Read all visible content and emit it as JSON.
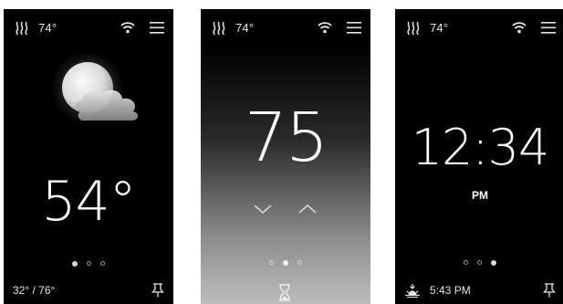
{
  "screens": [
    {
      "id": "weather",
      "status": {
        "temperature": "74°"
      },
      "weather_icon": "moon-behind-cloud-icon",
      "main_value": "54°",
      "pager": {
        "count": 3,
        "active": 0
      },
      "footer": {
        "range": "32° / 76°",
        "pin_icon": "pin-icon"
      }
    },
    {
      "id": "setpoint",
      "status": {
        "temperature": "74°"
      },
      "main_value": "75",
      "controls": {
        "decrease_icon": "chevron-down-icon",
        "increase_icon": "chevron-up-icon"
      },
      "pager": {
        "count": 3,
        "active": 1
      },
      "footer": {
        "timer_icon": "hourglass-icon"
      }
    },
    {
      "id": "clock",
      "status": {
        "temperature": "74°"
      },
      "main_value": "12:34",
      "meridiem": "PM",
      "pager": {
        "count": 3,
        "active": 2
      },
      "footer": {
        "sunset_time": "5:43 PM",
        "sunset_icon": "sunset-icon",
        "pin_icon": "pin-icon"
      }
    }
  ],
  "colors": {
    "screen_background": "#000000",
    "text": "#ffffff",
    "page_background": "#ffffff"
  }
}
